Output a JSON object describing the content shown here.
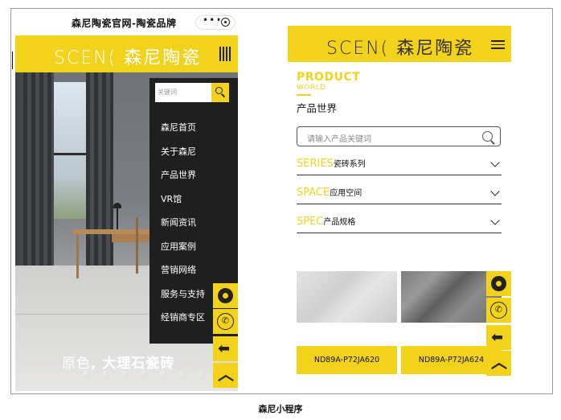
{
  "caption": "森尼小程序",
  "left_phone": {
    "title": "森尼陶瓷官网-陶瓷品牌",
    "capsule_dots": "•••",
    "logo_text": "SCEN( 森尼陶瓷",
    "search_placeholder": "关键词",
    "menu_items": [
      "森尼首页",
      "关于森尼",
      "产品世界",
      "VR馆",
      "新闻资讯",
      "应用案例",
      "营销网络",
      "服务与支持",
      "经销商专区"
    ],
    "slogan_main_thin": "原色",
    "slogan_main_bold": "大理石瓷砖",
    "slogan_sub": "做 原 时 代 的 色 彩",
    "float_icons": [
      "disc-icon",
      "phone-icon",
      "back-arrow-icon",
      "up-arrow-icon"
    ]
  },
  "right_phone": {
    "logo_text": "SCEN( 森尼陶瓷",
    "product_title": "PRODUCT",
    "product_sub": "WORLD",
    "product_cn": "产品世界",
    "search_placeholder": "请输入产品关键词",
    "filters": [
      {
        "en": "SERIES",
        "cn": "瓷砖系列"
      },
      {
        "en": "SPACE",
        "cn": "应用空间"
      },
      {
        "en": "SPEC",
        "cn": "产品规格"
      }
    ],
    "products": [
      {
        "code": "ND89A-P72JA620"
      },
      {
        "code": "ND89A-P72JA624"
      }
    ]
  },
  "colors": {
    "brand_yellow": "#f2d21b",
    "menu_bg": "#1f1f1f"
  }
}
